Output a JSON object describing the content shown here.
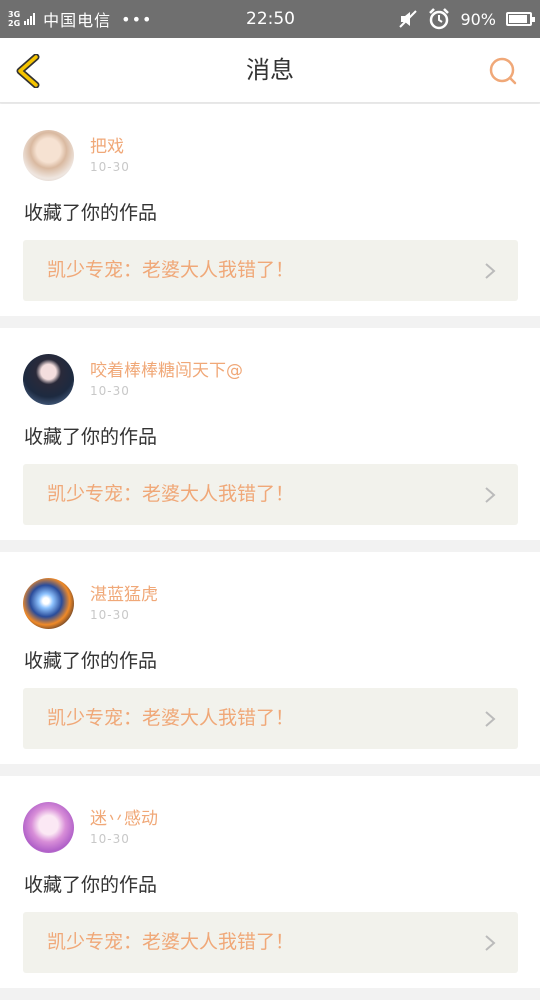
{
  "status_bar": {
    "net_top": "3G",
    "net_bottom": "2G",
    "carrier": "中国电信",
    "dots": "•••",
    "time": "22:50",
    "battery_text": "90%",
    "battery_level": 0.9
  },
  "header": {
    "title": "消息",
    "back_icon": "chevron-left-icon",
    "search_icon": "search-icon"
  },
  "colors": {
    "accent": "#f0a878",
    "back_chevron": "#f5c400",
    "work_bg": "#f2f2ec"
  },
  "messages": [
    {
      "username": "把戏",
      "time": "10-30",
      "action": "收藏了你的作品",
      "work_title": "凯少专宠：老婆大人我错了！"
    },
    {
      "username": "咬着棒棒糖闯天下@",
      "time": "10-30",
      "action": "收藏了你的作品",
      "work_title": "凯少专宠：老婆大人我错了！"
    },
    {
      "username": "湛蓝猛虎",
      "time": "10-30",
      "action": "收藏了你的作品",
      "work_title": "凯少专宠：老婆大人我错了！"
    },
    {
      "username": "迷丷感动",
      "time": "10-30",
      "action": "收藏了你的作品",
      "work_title": "凯少专宠：老婆大人我错了！"
    }
  ]
}
